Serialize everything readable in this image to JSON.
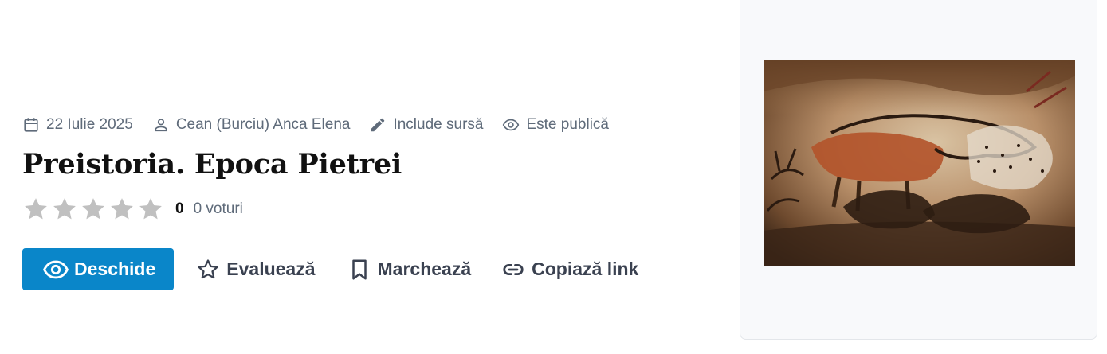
{
  "meta": {
    "date": "22 Iulie 2025",
    "author": "Cean (Burciu) Anca Elena",
    "source": "Include sursă",
    "visibility": "Este publică"
  },
  "title": "Preistoria. Epoca Pietrei",
  "rating": {
    "stars_filled": 0,
    "stars_total": 5,
    "score": "0",
    "votes": "0 voturi"
  },
  "actions": {
    "open": "Deschide",
    "rate": "Evaluează",
    "bookmark": "Marchează",
    "copy_link": "Copiază link"
  },
  "icons": {
    "date": "calendar-icon",
    "author": "person-icon",
    "source": "pencil-icon",
    "visibility": "eye-icon",
    "rate": "star-outline-icon",
    "bookmark": "bookmark-icon",
    "copy_link": "link-icon"
  },
  "colors": {
    "primary": "#0a86c9",
    "meta_text": "#5f6b7a",
    "star_empty": "#c0c0c0",
    "action_text": "#3a4150"
  }
}
